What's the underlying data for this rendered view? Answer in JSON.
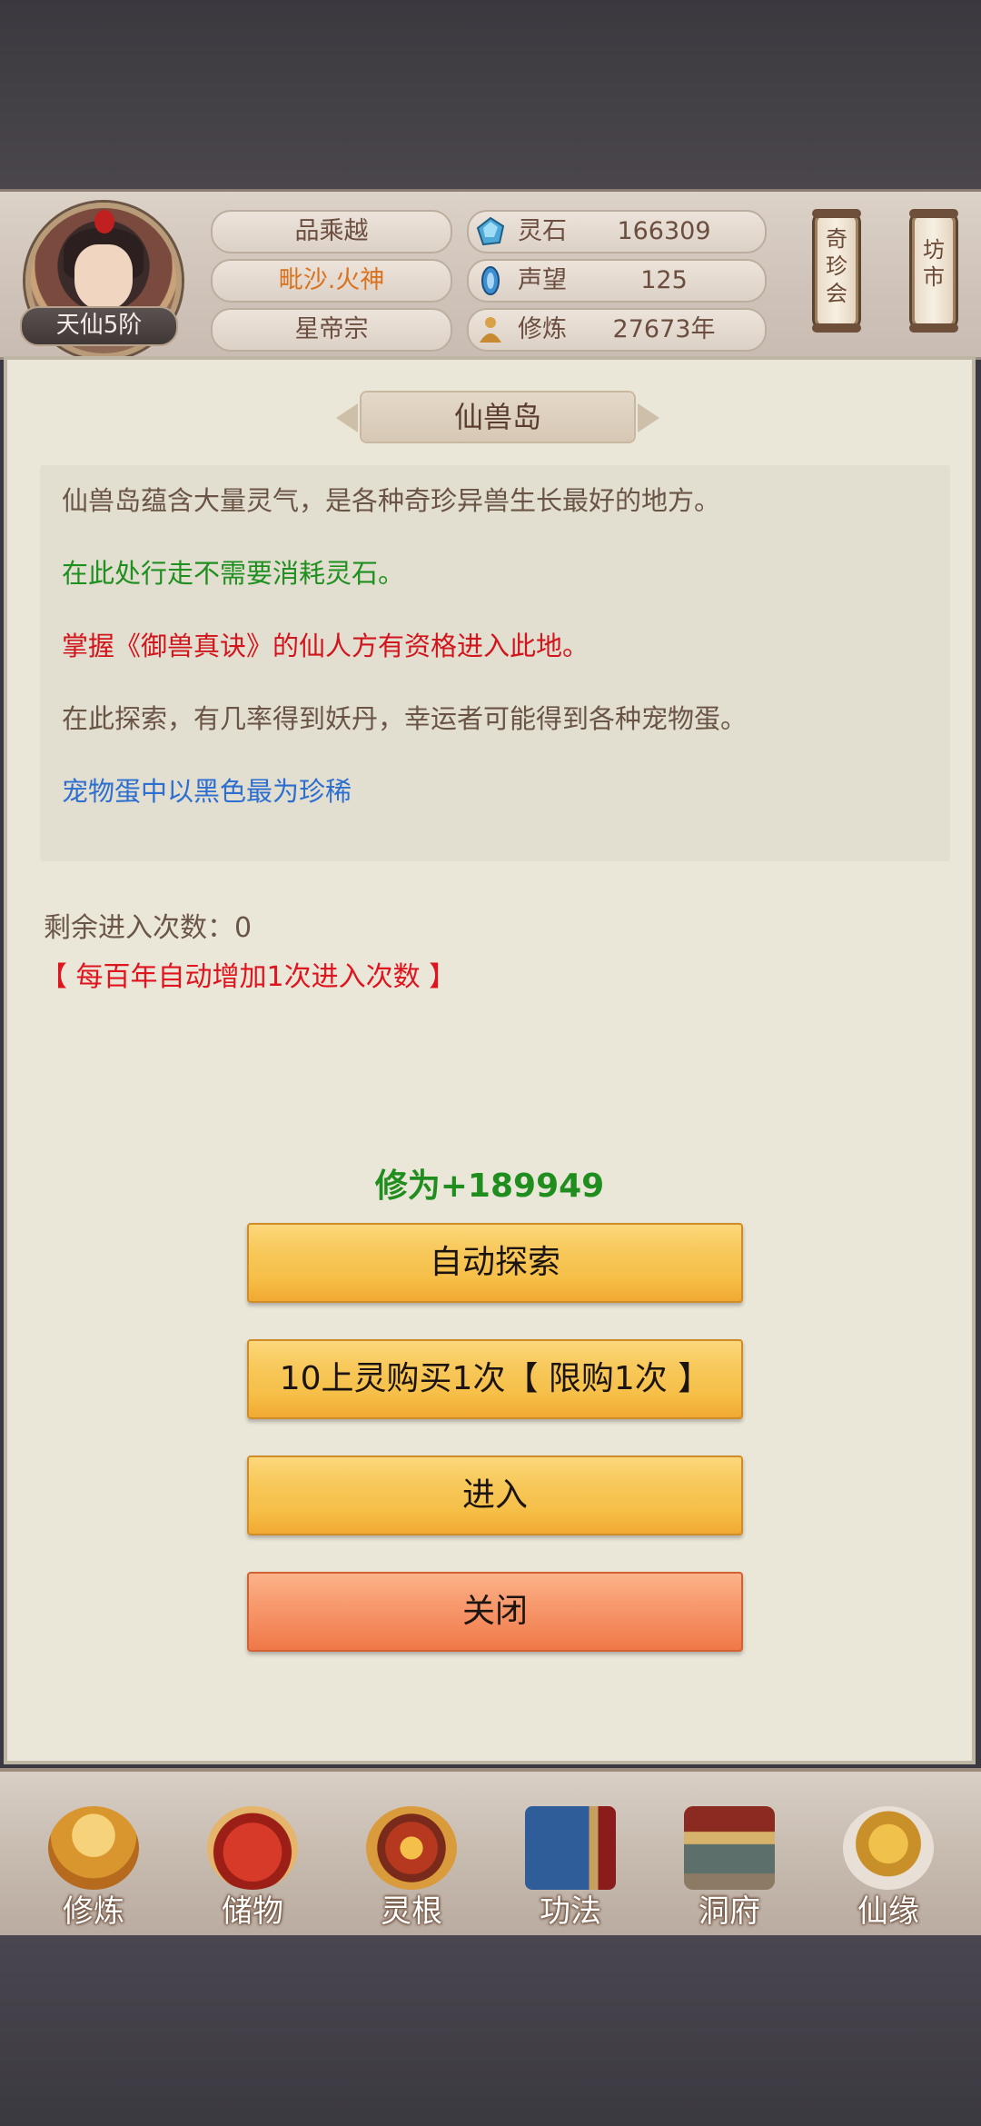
{
  "header": {
    "avatar_realm": "天仙5阶",
    "player_name": "品乘越",
    "title": "毗沙.火神",
    "sect": "星帝宗",
    "resources": [
      {
        "icon": "spirit-stone-icon",
        "label": "灵石",
        "value": "166309"
      },
      {
        "icon": "prestige-icon",
        "label": "声望",
        "value": "125"
      },
      {
        "icon": "cultivation-icon",
        "label": "修炼",
        "value": "27673年"
      }
    ],
    "side_buttons": [
      {
        "chars": [
          "奇",
          "珍",
          "会"
        ]
      },
      {
        "chars": [
          "坊",
          "市"
        ]
      }
    ]
  },
  "panel": {
    "title": "仙兽岛",
    "description": [
      {
        "text": "仙兽岛蕴含大量灵气，是各种奇珍异兽生长最好的地方。",
        "color": "#6a5446"
      },
      {
        "text": "在此处行走不需要消耗灵石。",
        "color": "#1f8f1f"
      },
      {
        "text": "掌握《御兽真诀》的仙人方有资格进入此地。",
        "color": "#d2141c"
      },
      {
        "text": "在此探索，有几率得到妖丹，幸运者可能得到各种宠物蛋。",
        "color": "#6a5446"
      },
      {
        "text": "宠物蛋中以黑色最为珍稀",
        "color": "#2c6fd1"
      }
    ],
    "remaining_entries": "剩余进入次数：0",
    "bonus_note": "【 每百年自动增加1次进入次数 】",
    "reward": "修为+189949",
    "buttons": {
      "auto_explore": "自动探索",
      "buy_once": "10上灵购买1次【 限购1次 】",
      "enter": "进入",
      "close": "关闭"
    }
  },
  "nav": {
    "items": [
      {
        "label": "修炼",
        "icon": "cultivate-icon"
      },
      {
        "label": "储物",
        "icon": "storage-bag-icon"
      },
      {
        "label": "灵根",
        "icon": "spirit-root-icon"
      },
      {
        "label": "功法",
        "icon": "technique-book-icon"
      },
      {
        "label": "洞府",
        "icon": "cave-mansion-icon"
      },
      {
        "label": "仙缘",
        "icon": "immortal-fate-icon"
      }
    ]
  },
  "colors": {
    "reward_green": "#1f8e1f",
    "warning_red": "#e0141e",
    "button_gold": "#f6bf48",
    "button_orange": "#f38758"
  }
}
